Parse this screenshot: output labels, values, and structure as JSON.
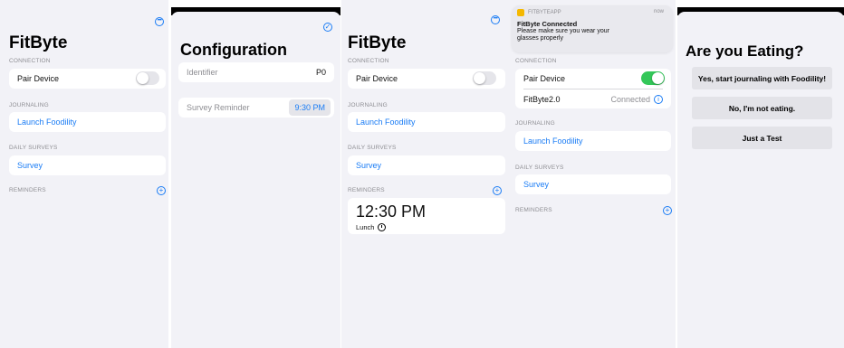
{
  "screen1": {
    "title": "FitByte",
    "connection_header": "CONNECTION",
    "pair_device_label": "Pair Device",
    "journaling_header": "JOURNALING",
    "launch_label": "Launch Foodility",
    "daily_surveys_header": "DAILY SURVEYS",
    "survey_label": "Survey",
    "reminders_header": "REMINDERS",
    "pair_toggle_on": false
  },
  "screen2": {
    "title": "Configuration",
    "identifier_label": "Identifier",
    "identifier_value": "P0",
    "survey_reminder_label": "Survey Reminder",
    "survey_reminder_time": "9:30 PM"
  },
  "screen3": {
    "title": "FitByte",
    "connection_header": "CONNECTION",
    "pair_device_label": "Pair Device",
    "journaling_header": "JOURNALING",
    "launch_label": "Launch Foodility",
    "daily_surveys_header": "DAILY SURVEYS",
    "survey_label": "Survey",
    "reminders_header": "REMINDERS",
    "reminder_time": "12:30 PM",
    "reminder_name": "Lunch",
    "pair_toggle_on": false
  },
  "screen4": {
    "notification": {
      "app": "FITBYTEAPP",
      "time": "now",
      "title": "FitByte Connected",
      "body1": "Please make sure you wear your",
      "body2": "glasses properly"
    },
    "connection_header": "CONNECTION",
    "pair_device_label": "Pair Device",
    "device_name": "FitByte2.0",
    "device_status": "Connected",
    "journaling_header": "JOURNALING",
    "launch_label": "Launch Foodility",
    "daily_surveys_header": "DAILY SURVEYS",
    "survey_label": "Survey",
    "reminders_header": "REMINDERS",
    "pair_toggle_on": true
  },
  "screen5": {
    "title": "Are you Eating?",
    "yes_label": "Yes, start journaling with Foodility!",
    "no_label": "No, I'm not eating.",
    "test_label": "Just a Test"
  },
  "colors": {
    "accent": "#1a7cf5",
    "toggle_on": "#34c759",
    "background": "#f2f2f7"
  },
  "icons": [
    "more-icon",
    "checkmark-icon",
    "add-icon",
    "info-icon",
    "clock-icon",
    "app-icon"
  ]
}
